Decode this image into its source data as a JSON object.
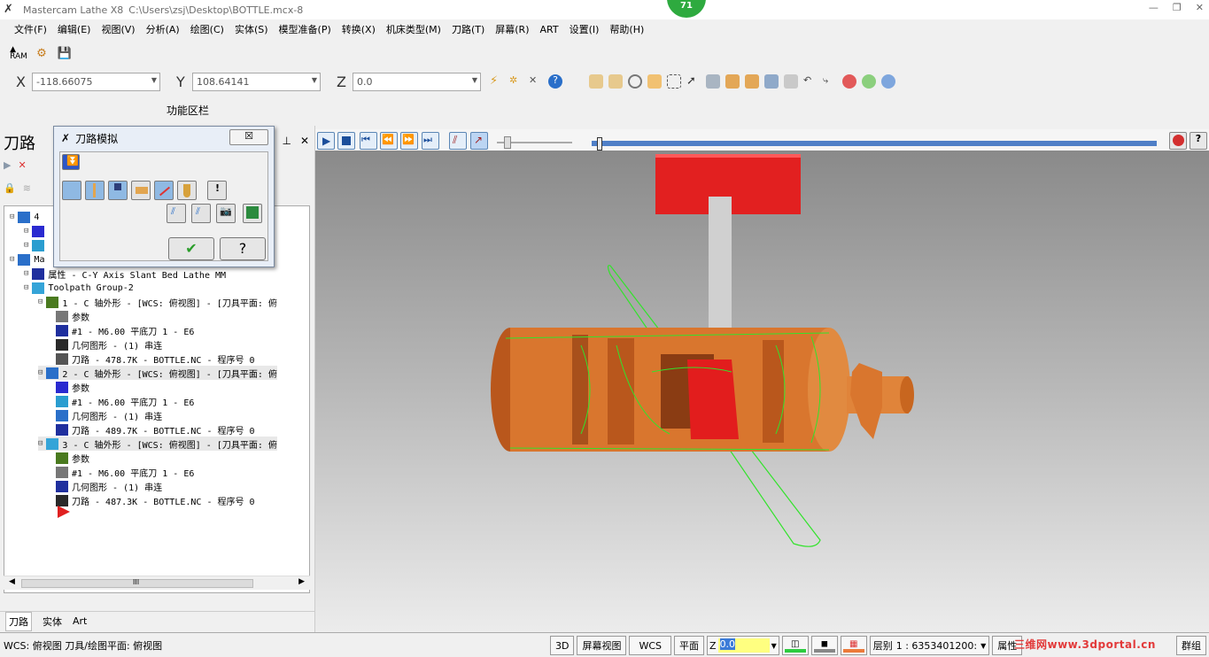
{
  "title": {
    "app": "Mastercam Lathe X8",
    "path": "C:\\Users\\zsj\\Desktop\\BOTTLE.mcx-8"
  },
  "badge": "71",
  "menu": [
    "文件(F)",
    "编辑(E)",
    "视图(V)",
    "分析(A)",
    "绘图(C)",
    "实体(S)",
    "模型准备(P)",
    "转换(X)",
    "机床类型(M)",
    "刀路(T)",
    "屏幕(R)",
    "ART",
    "设置(I)",
    "帮助(H)"
  ],
  "coords": {
    "x_label": "X",
    "x_value": "-118.66075",
    "y_label": "Y",
    "y_value": "108.64141",
    "z_label": "Z",
    "z_value": "0.0"
  },
  "func_label": "功能区栏",
  "panel": {
    "title": "刀路",
    "tabs": [
      "刀路",
      "实体",
      "Art"
    ]
  },
  "dialog": {
    "title": "刀路模拟",
    "close": "☒",
    "ok": "✔",
    "help": "?"
  },
  "tree": [
    {
      "text": "4",
      "indent": 0
    },
    {
      "text": "",
      "indent": 1
    },
    {
      "text": "",
      "indent": 1
    },
    {
      "text": "Ma",
      "indent": 0
    },
    {
      "text": "属性 - C-Y Axis Slant Bed Lathe MM",
      "indent": 1
    },
    {
      "text": "Toolpath Group-2",
      "indent": 1
    },
    {
      "text": "1 - C 轴外形 - [WCS: 俯视图] - [刀具平面: 俯",
      "indent": 2,
      "sel": false
    },
    {
      "text": "参数",
      "indent": 3
    },
    {
      "text": "#1 - M6.00 平底刀 1 - E6",
      "indent": 3
    },
    {
      "text": "几何图形 - (1) 串连",
      "indent": 3
    },
    {
      "text": "刀路 - 478.7K - BOTTLE.NC - 程序号 0",
      "indent": 3
    },
    {
      "text": "2 - C 轴外形 - [WCS: 俯视图] - [刀具平面: 俯",
      "indent": 2,
      "sel": true
    },
    {
      "text": "参数",
      "indent": 3
    },
    {
      "text": "#1 - M6.00 平底刀 1 - E6",
      "indent": 3
    },
    {
      "text": "几何图形 - (1) 串连",
      "indent": 3
    },
    {
      "text": "刀路 - 489.7K - BOTTLE.NC - 程序号 0",
      "indent": 3
    },
    {
      "text": "3 - C 轴外形 - [WCS: 俯视图] - [刀具平面: 俯",
      "indent": 2,
      "sel": true
    },
    {
      "text": "参数",
      "indent": 3
    },
    {
      "text": "#1 - M6.00 平底刀 1 - E6",
      "indent": 3
    },
    {
      "text": "几何图形 - (1) 串连",
      "indent": 3
    },
    {
      "text": "刀路 - 487.3K - BOTTLE.NC - 程序号 0",
      "indent": 3
    }
  ],
  "scroll_label": "III",
  "status": {
    "wcs": "WCS: 俯视图  刀具/绘图平面: 俯视图",
    "btn_3d": "3D",
    "screen_view": "屏幕视图",
    "wcs_btn": "WCS",
    "plane": "平面",
    "z": "Z",
    "z_val": "0.0",
    "layer_label": "层别",
    "layer_val": "1 : 6353401200:",
    "attr": "属性",
    "group": "群组"
  },
  "watermark": "三维网www.3dportal.cn",
  "colors": {
    "part": "#d9762e",
    "tool": "#e82b2b",
    "path": "#32e32b",
    "timeline": "#4f7fc7"
  }
}
